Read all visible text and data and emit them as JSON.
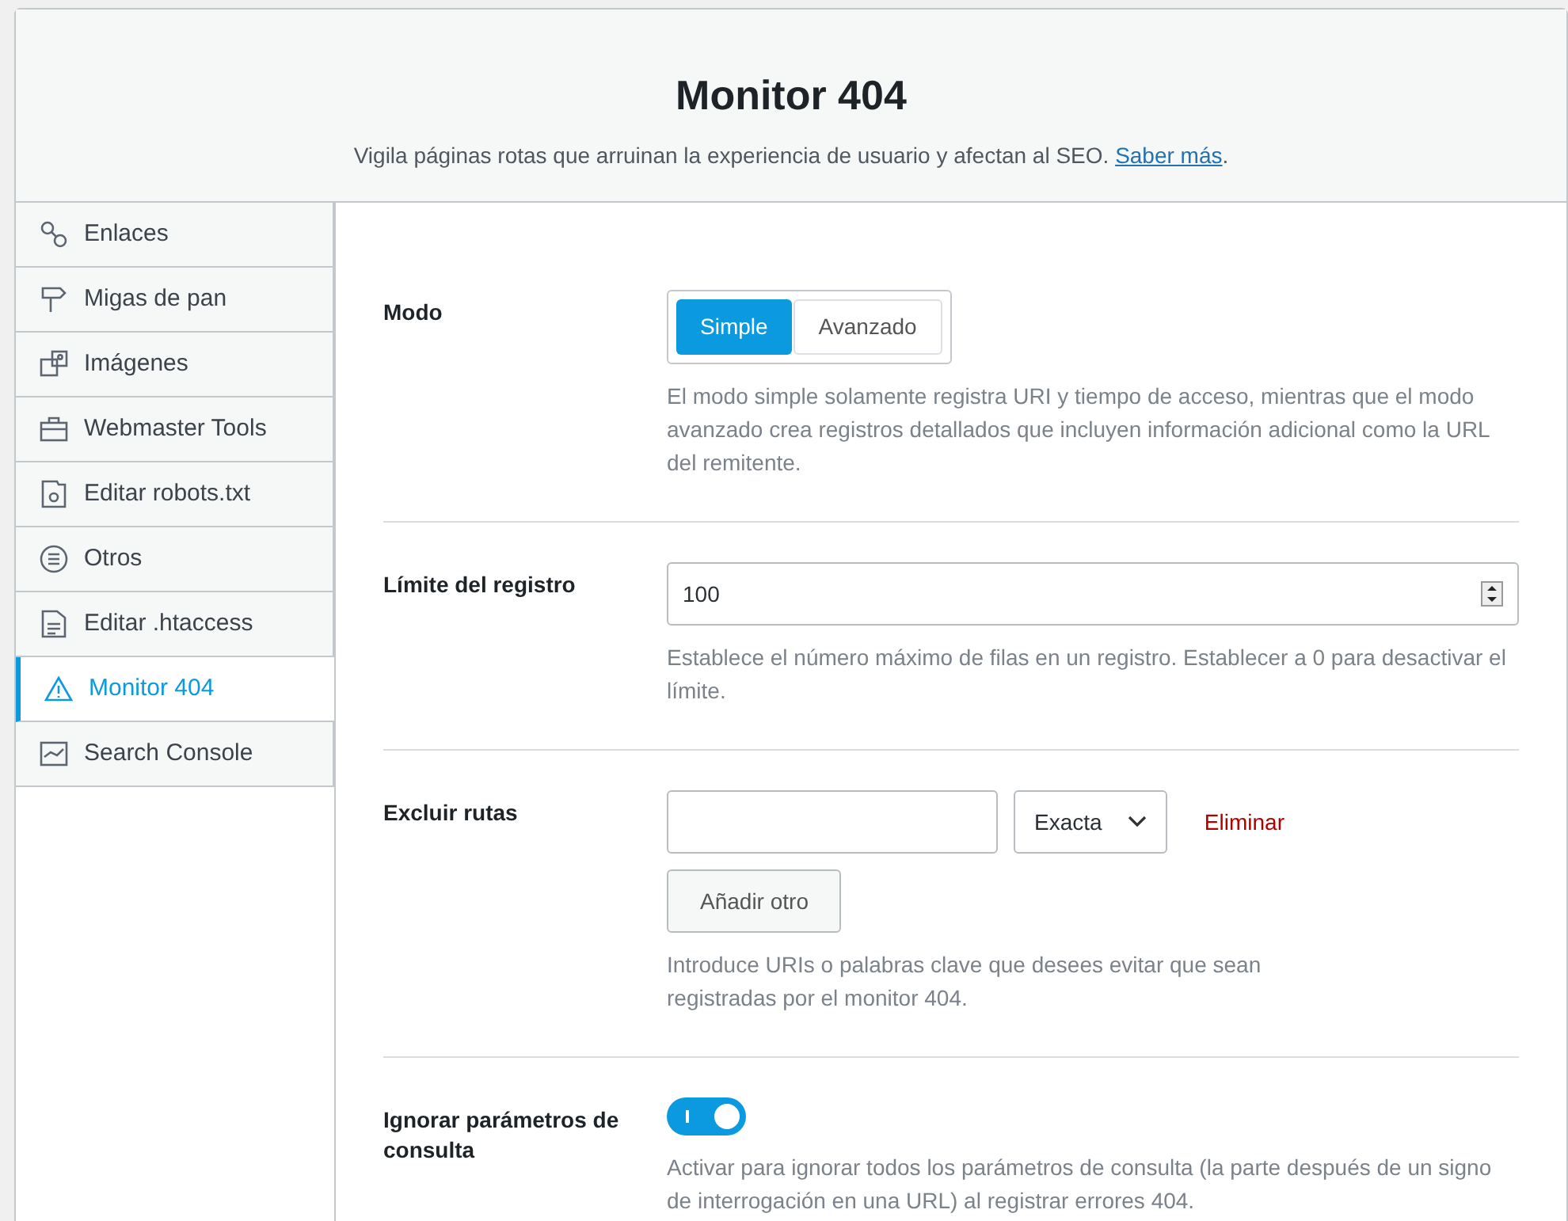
{
  "header": {
    "title": "Monitor 404",
    "description": "Vigila páginas rotas que arruinan la experiencia de usuario y afectan al SEO.",
    "link": "Saber más",
    "link_suffix": "."
  },
  "sidebar": {
    "items": [
      {
        "label": "Enlaces",
        "selected": false
      },
      {
        "label": "Migas de pan",
        "selected": false
      },
      {
        "label": "Imágenes",
        "selected": false
      },
      {
        "label": "Webmaster Tools",
        "selected": false
      },
      {
        "label": "Editar robots.txt",
        "selected": false
      },
      {
        "label": "Otros",
        "selected": false
      },
      {
        "label": "Editar .htaccess",
        "selected": false
      },
      {
        "label": "Monitor 404",
        "selected": true
      },
      {
        "label": "Search Console",
        "selected": false
      }
    ]
  },
  "settings": [
    {
      "kind": "segmented",
      "label": "Modo",
      "options": [
        {
          "label": "Simple",
          "selected": true
        },
        {
          "label": "Avanzado",
          "selected": false
        }
      ],
      "help": "El modo simple solamente registra URI y tiempo de acceso, mientras que el modo avanzado crea registros detallados que incluyen información adicional como la URL del remitente."
    },
    {
      "kind": "number",
      "label": "Límite del registro",
      "value": "100",
      "help": "Establece el número máximo de filas en un registro. Establecer a 0 para desactivar el límite."
    },
    {
      "kind": "exclude",
      "label": "Excluir rutas",
      "match": "Exacta",
      "remove": "Eliminar",
      "add": "Añadir otro",
      "help": "Introduce URIs o palabras clave que desees evitar que sean registradas por el monitor 404."
    },
    {
      "kind": "toggle",
      "label": "Ignorar parámetros de consulta",
      "on": true,
      "help": "Activar para ignorar todos los parámetros de consulta (la parte después de un signo de interrogación en una URL) al registrar errores 404."
    }
  ]
}
